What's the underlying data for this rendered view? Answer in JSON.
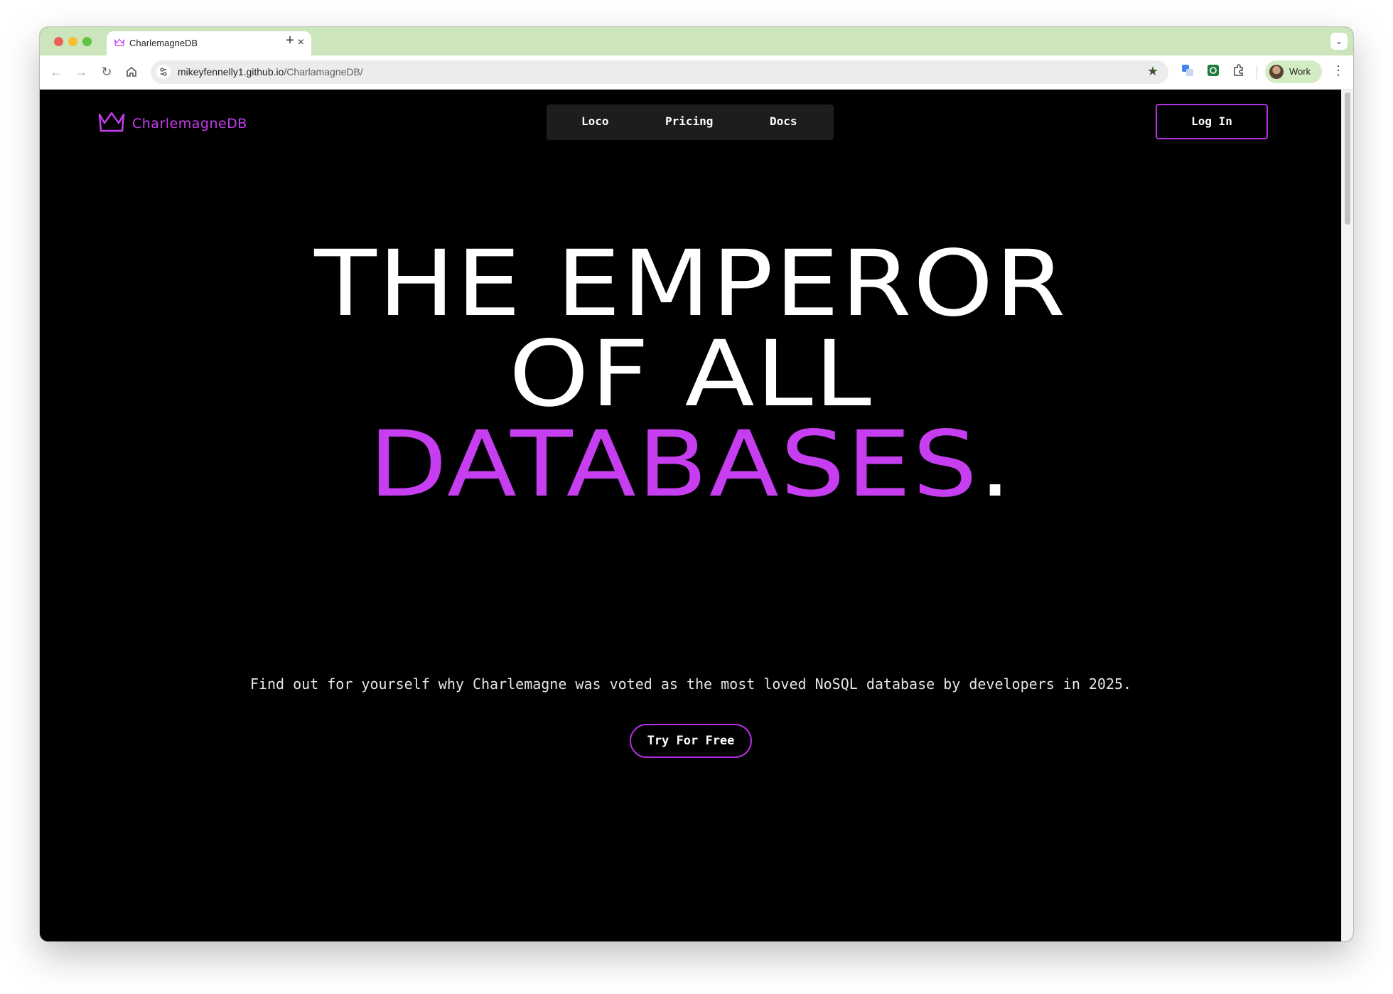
{
  "browser": {
    "tab_title": "CharlemagneDB",
    "tab_close": "×",
    "new_tab": "+",
    "url_host": "mikeyfennelly1.github.io",
    "url_path": "/CharlamagneDB/",
    "profile_label": "Work"
  },
  "site": {
    "brand_name": "CharlemagneDB",
    "nav": {
      "loco": "Loco",
      "pricing": "Pricing",
      "docs": "Docs"
    },
    "login_label": "Log In",
    "hero": {
      "line1": "THE EMPEROR",
      "line2": "OF ALL",
      "line3_accent": "DATABASES",
      "line3_period": "."
    },
    "tagline": "Find out for yourself why Charlemagne was voted as the most loved NoSQL database by developers in 2025.",
    "cta_label": "Try For Free"
  },
  "colors": {
    "accent": "#c63ef0",
    "background": "#000000",
    "tab_strip": "#cde5bd"
  },
  "icons": [
    "crown-icon",
    "back-arrow-icon",
    "forward-arrow-icon",
    "reload-icon",
    "home-icon",
    "site-info-icon",
    "bookmark-star-icon",
    "translate-icon",
    "extension-icon",
    "puzzle-icon",
    "more-menu-icon",
    "tab-search-icon"
  ]
}
